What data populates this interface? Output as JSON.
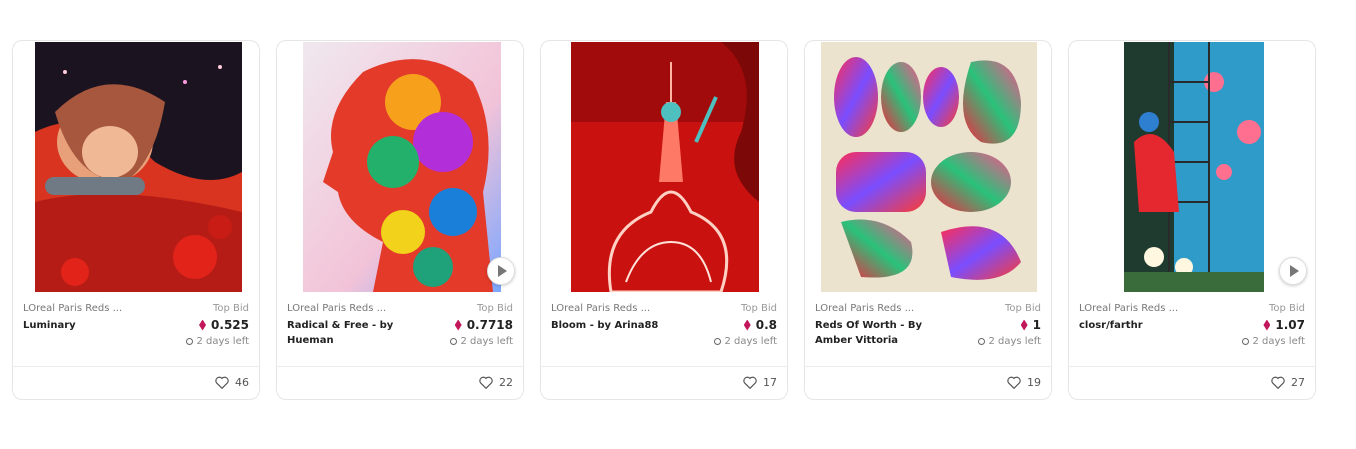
{
  "cards": [
    {
      "collection": "LOreal Paris Reds ...",
      "bid_label": "Top Bid",
      "title": "Luminary",
      "price": "0.525",
      "time_left": "2 days left",
      "likes": "46",
      "video": false
    },
    {
      "collection": "LOreal Paris Reds ...",
      "bid_label": "Top Bid",
      "title": "Radical & Free - by Hueman",
      "price": "0.7718",
      "time_left": "2 days left",
      "likes": "22",
      "video": true
    },
    {
      "collection": "LOreal Paris Reds ...",
      "bid_label": "Top Bid",
      "title": "Bloom - by Arina88",
      "price": "0.8",
      "time_left": "2 days left",
      "likes": "17",
      "video": false
    },
    {
      "collection": "LOreal Paris Reds ...",
      "bid_label": "Top Bid",
      "title": "Reds Of Worth - By Amber Vittoria",
      "price": "1",
      "time_left": "2 days left",
      "likes": "19",
      "video": false
    },
    {
      "collection": "LOreal Paris Reds ...",
      "bid_label": "Top Bid",
      "title": "closr/farthr",
      "price": "1.07",
      "time_left": "2 days left",
      "likes": "27",
      "video": true
    }
  ],
  "icons": {
    "currency": "eth-diamond-icon",
    "time": "clock-icon",
    "likes": "heart-icon",
    "video": "play-icon"
  },
  "colors": {
    "accent": "#c2185b",
    "border": "#e6e6e6"
  }
}
